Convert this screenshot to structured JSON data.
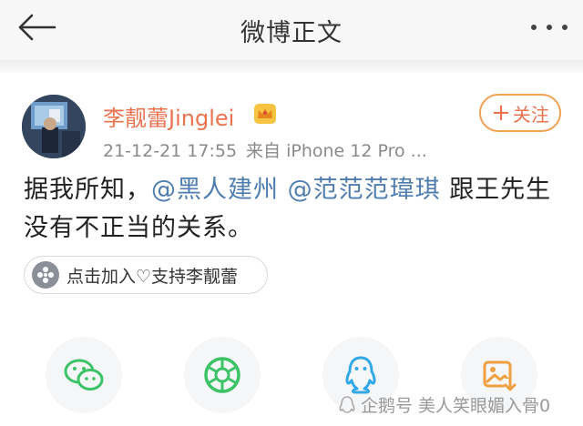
{
  "header": {
    "title": "微博正文",
    "back_icon": "back-arrow-icon",
    "more_icon": "more-dots-icon"
  },
  "user": {
    "name": "李靓蕾Jinglei",
    "time": "21-12-21 17:55",
    "source": "来自 iPhone 12 Pro ...",
    "vip_icon": "crown-icon"
  },
  "follow_button": {
    "plus": "+",
    "label": "关注"
  },
  "post": {
    "text_before": "据我所知，",
    "mention_1": "@黑人建州",
    "mention_2": "@范范范瑋琪",
    "text_after": "跟王先生没有不正当的关系。"
  },
  "support_chip": {
    "label": "点击加入♡支持李靓蕾"
  },
  "share_icons": [
    "wechat-icon",
    "moments-icon",
    "qq-icon",
    "save-image-icon"
  ],
  "watermark": {
    "text": "企鹅号 美人笑眼媚入骨0"
  },
  "colors": {
    "username": "#eb7350",
    "mention": "#507daf",
    "follow_border": "#f0a256",
    "wechat_green": "#3cc267"
  }
}
